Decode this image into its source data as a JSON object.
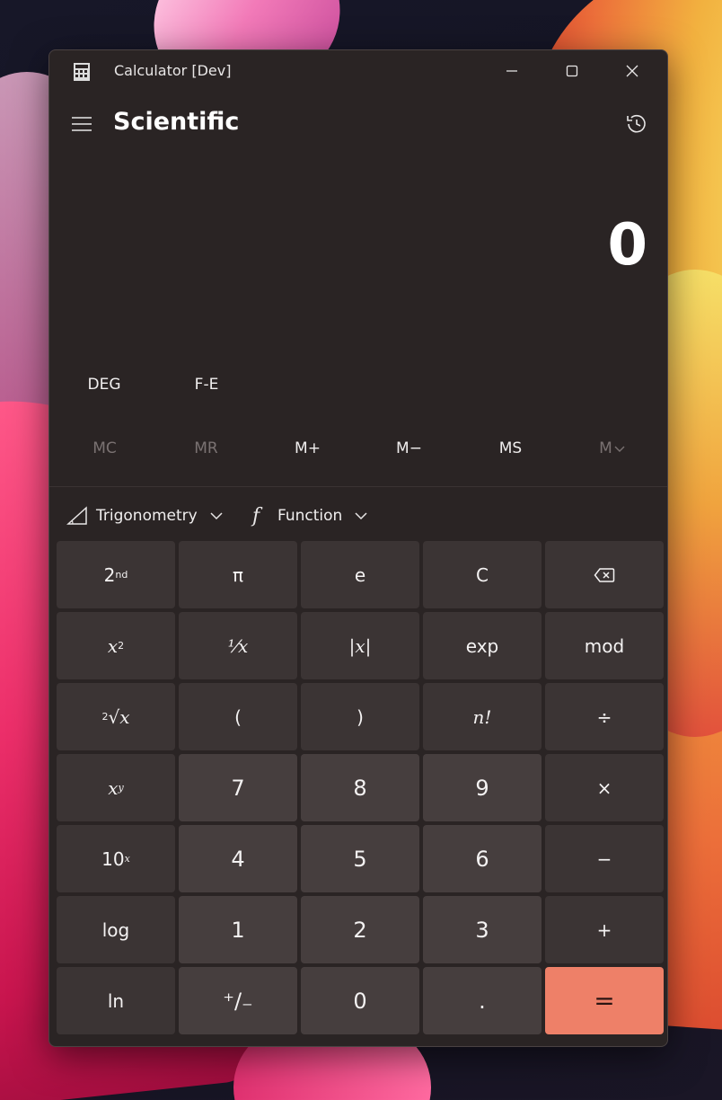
{
  "window": {
    "title": "Calculator [Dev]"
  },
  "header": {
    "mode": "Scientific"
  },
  "display": {
    "value": "0"
  },
  "angle_controls": {
    "angle_unit": "DEG",
    "fe": "F-E"
  },
  "memory": {
    "mc": "MC",
    "mr": "MR",
    "mplus": "M+",
    "mminus": "M−",
    "ms": "MS",
    "mlist": "M"
  },
  "functions_bar": {
    "trigonometry": "Trigonometry",
    "function": "Function"
  },
  "keys": {
    "second": "2",
    "second_sup": "nd",
    "pi": "π",
    "e": "e",
    "clear": "C",
    "square": "x",
    "square_sup": "2",
    "reciprocal": "⅟x",
    "abs": "|x|",
    "exp": "exp",
    "mod": "mod",
    "root_index": "2",
    "root": "√x",
    "lparen": "(",
    "rparen": ")",
    "factorial": "n!",
    "divide": "÷",
    "power": "x",
    "power_sup": "y",
    "seven": "7",
    "eight": "8",
    "nine": "9",
    "multiply": "×",
    "tenpow": "10",
    "tenpow_sup": "x",
    "four": "4",
    "five": "5",
    "six": "6",
    "minus": "−",
    "log": "log",
    "one": "1",
    "two": "2",
    "three": "3",
    "plus": "+",
    "ln": "ln",
    "negate": "⁺∕₋",
    "zero": "0",
    "decimal": ".",
    "equals": "="
  },
  "colors": {
    "window_bg": "#2a2424",
    "key_bg": "#3b3434",
    "number_key_bg": "#463e3e",
    "accent": "#ee8068"
  }
}
